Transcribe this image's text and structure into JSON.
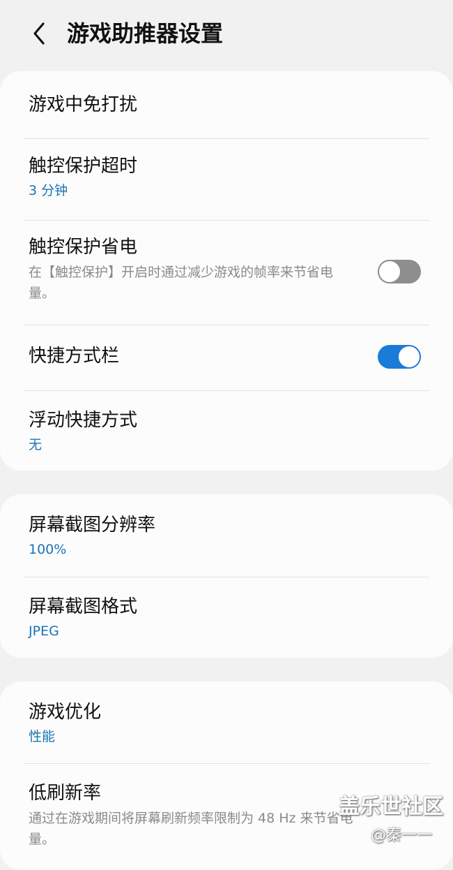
{
  "header": {
    "title": "游戏助推器设置"
  },
  "group1": {
    "dnd_title": "游戏中免打扰",
    "touch_timeout_title": "触控保护超时",
    "touch_timeout_value": "3 分钟",
    "touch_power_title": "触控保护省电",
    "touch_power_desc": "在【触控保护】开启时通过减少游戏的帧率来节省电量。",
    "touch_power_enabled": false,
    "shortcut_bar_title": "快捷方式栏",
    "shortcut_bar_enabled": true,
    "floating_title": "浮动快捷方式",
    "floating_value": "无"
  },
  "group2": {
    "resolution_title": "屏幕截图分辨率",
    "resolution_value": "100%",
    "format_title": "屏幕截图格式",
    "format_value": "JPEG"
  },
  "group3": {
    "optimize_title": "游戏优化",
    "optimize_value": "性能",
    "low_refresh_title": "低刷新率",
    "low_refresh_desc": "通过在游戏期间将屏幕刷新频率限制为 48 Hz 来节省电量。"
  },
  "watermark": {
    "main": "盖乐世社区",
    "sub": "@秦一一"
  },
  "colors": {
    "accent": "#1a73b5",
    "toggle_on": "#1a7bd8",
    "toggle_off": "#8e8e8e",
    "background": "#f1f1f1",
    "card": "#fcfcfc"
  },
  "icons": {
    "back": "back-arrow-icon"
  }
}
